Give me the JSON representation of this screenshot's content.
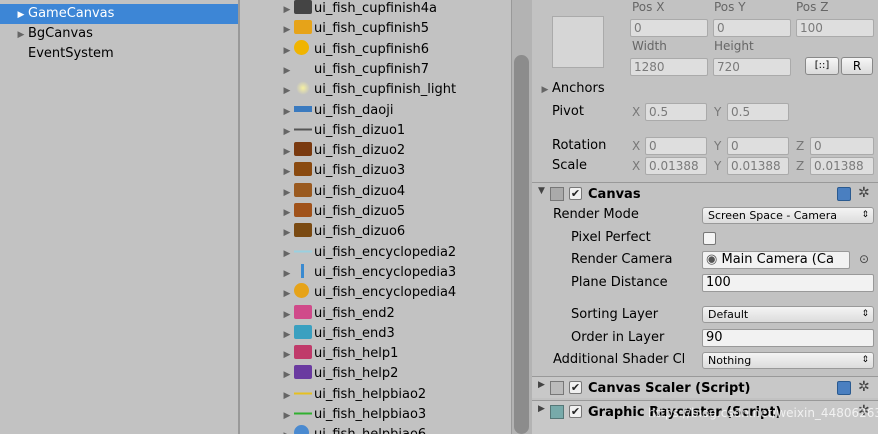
{
  "hierarchy": {
    "items": [
      {
        "label": "GameCanvas",
        "selected": true,
        "expandable": true
      },
      {
        "label": "BgCanvas",
        "selected": false,
        "expandable": true
      },
      {
        "label": "EventSystem",
        "selected": false,
        "expandable": false
      }
    ]
  },
  "project": {
    "items": [
      {
        "label": "ui_fish_cupfinish4a",
        "icon": "swirl-icon",
        "color": "#444444"
      },
      {
        "label": "ui_fish_cupfinish5",
        "icon": "flower-icon",
        "color": "#e6a319"
      },
      {
        "label": "ui_fish_cupfinish6",
        "icon": "coin-icon",
        "color": "#f0b400"
      },
      {
        "label": "ui_fish_cupfinish7",
        "icon": "blank-icon",
        "color": "#d0d0d0"
      },
      {
        "label": "ui_fish_cupfinish_light",
        "icon": "glow-icon",
        "color": "#f6f0a0"
      },
      {
        "label": "ui_fish_daoji",
        "icon": "bar-icon",
        "color": "#3a7abf"
      },
      {
        "label": "ui_fish_dizuo1",
        "icon": "line-icon",
        "color": "#555555"
      },
      {
        "label": "ui_fish_dizuo2",
        "icon": "wood-icon",
        "color": "#7a3a10"
      },
      {
        "label": "ui_fish_dizuo3",
        "icon": "wood-icon",
        "color": "#8a4a10"
      },
      {
        "label": "ui_fish_dizuo4",
        "icon": "wood-icon",
        "color": "#9a5a20"
      },
      {
        "label": "ui_fish_dizuo5",
        "icon": "wood-icon",
        "color": "#a0521a"
      },
      {
        "label": "ui_fish_dizuo6",
        "icon": "wood-icon",
        "color": "#7a4a12"
      },
      {
        "label": "ui_fish_encyclopedia2",
        "icon": "line-icon",
        "color": "#9ad0e0"
      },
      {
        "label": "ui_fish_encyclopedia3",
        "icon": "stick-icon",
        "color": "#3a8ad0"
      },
      {
        "label": "ui_fish_encyclopedia4",
        "icon": "coin-icon",
        "color": "#e6a319"
      },
      {
        "label": "ui_fish_end2",
        "icon": "chest-icon",
        "color": "#d04a8a"
      },
      {
        "label": "ui_fish_end3",
        "icon": "chest-icon",
        "color": "#3aa0c0"
      },
      {
        "label": "ui_fish_help1",
        "icon": "book-icon",
        "color": "#c03a6a"
      },
      {
        "label": "ui_fish_help2",
        "icon": "book-icon",
        "color": "#6a3aa0"
      },
      {
        "label": "ui_fish_helpbiao2",
        "icon": "line-icon",
        "color": "#e6c020"
      },
      {
        "label": "ui_fish_helpbiao3",
        "icon": "line-icon",
        "color": "#30b030"
      },
      {
        "label": "ui_fish_helpbiao6",
        "icon": "globe-icon",
        "color": "#4a8ad0"
      }
    ]
  },
  "inspector": {
    "rect": {
      "pos_x_label": "Pos X",
      "pos_y_label": "Pos Y",
      "pos_z_label": "Pos Z",
      "pos_x": "0",
      "pos_y": "0",
      "pos_z": "100",
      "width_label": "Width",
      "height_label": "Height",
      "width": "1280",
      "height": "720",
      "r_button": "R",
      "blueprint_button": "[::]"
    },
    "anchors_label": "Anchors",
    "pivot_label": "Pivot",
    "pivot_x": "0.5",
    "pivot_y": "0.5",
    "rotation_label": "Rotation",
    "rot_x": "0",
    "rot_y": "0",
    "rot_z": "0",
    "scale_label": "Scale",
    "scale_x": "0.01388",
    "scale_y": "0.01388",
    "scale_z": "0.01388",
    "axis_x": "X",
    "axis_y": "Y",
    "axis_z": "Z",
    "canvas": {
      "title": "Canvas",
      "render_mode_label": "Render Mode",
      "render_mode_value": "Screen Space - Camera",
      "pixel_perfect_label": "Pixel Perfect",
      "render_camera_label": "Render Camera",
      "render_camera_value": "Main Camera (Ca",
      "plane_distance_label": "Plane Distance",
      "plane_distance_value": "100",
      "sorting_layer_label": "Sorting Layer",
      "sorting_layer_value": "Default",
      "order_in_layer_label": "Order in Layer",
      "order_in_layer_value": "90",
      "shader_channels_label": "Additional Shader Cl",
      "shader_channels_value": "Nothing"
    },
    "canvas_scaler": {
      "title": "Canvas Scaler (Script)"
    },
    "graphic_raycaster": {
      "title": "Graphic Raycaster (Script)"
    },
    "watermark": "https://blog.csdn.net/weixin_44806263"
  }
}
